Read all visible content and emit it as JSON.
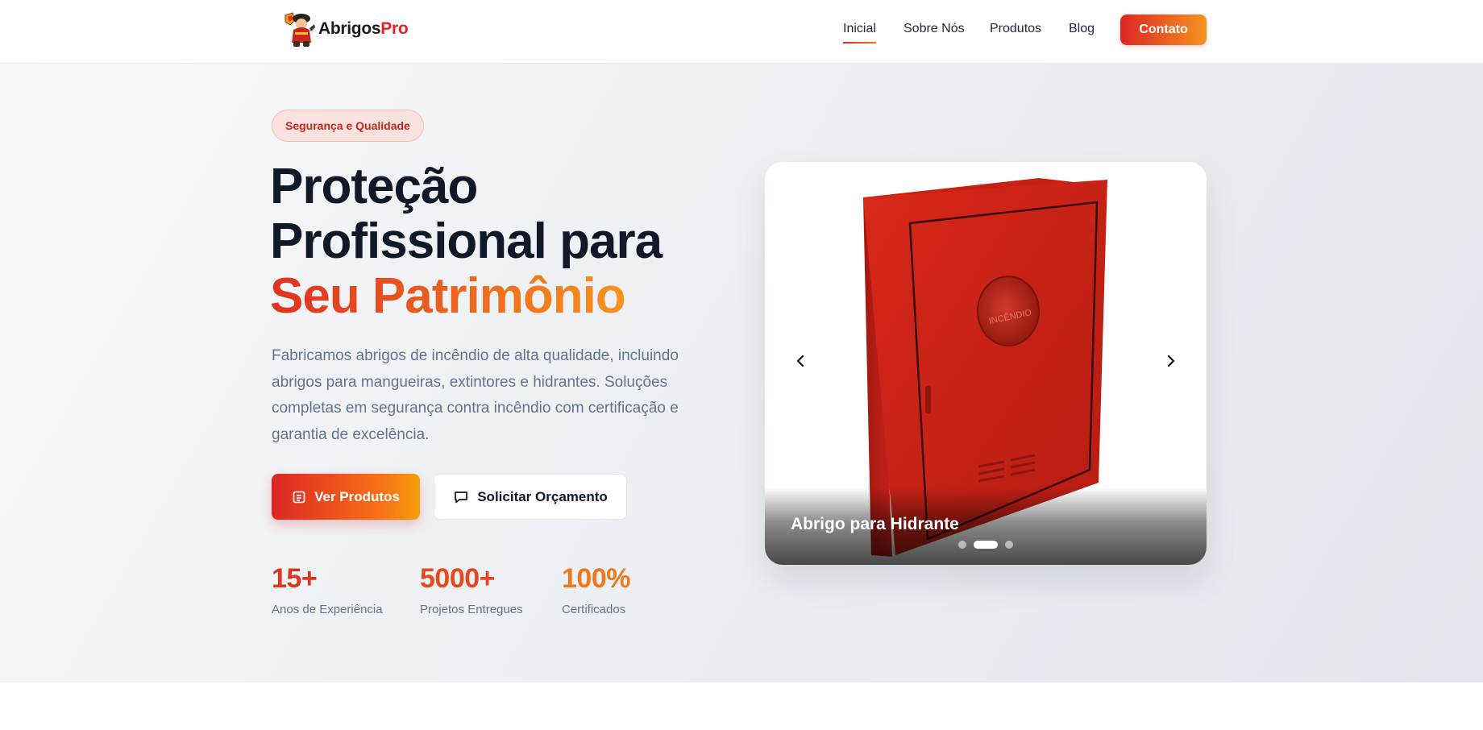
{
  "brand": {
    "name_part1": "Abrigos",
    "name_part2": "Pro"
  },
  "nav": {
    "items": [
      {
        "label": "Inicial",
        "active": true
      },
      {
        "label": "Sobre Nós"
      },
      {
        "label": "Produtos"
      },
      {
        "label": "Blog"
      }
    ],
    "contact_button": "Contato"
  },
  "hero": {
    "badge": "Segurança e Qualidade",
    "title_line1": "Proteção",
    "title_line2": "Profissional para",
    "title_highlight": "Seu Patrimônio",
    "description": "Fabricamos abrigos de incêndio de alta qualidade, incluindo abrigos para mangueiras, extintores e hidrantes. Soluções completas em segurança contra incêndio com certificação e garantia de excelência.",
    "primary_button": "Ver Produtos",
    "secondary_button": "Solicitar Orçamento",
    "stats": [
      {
        "value": "15+",
        "label": "Anos de Experiência"
      },
      {
        "value": "5000+",
        "label": "Projetos Entregues"
      },
      {
        "value": "100%",
        "label": "Certificados"
      }
    ]
  },
  "carousel": {
    "caption": "Abrigo para Hidrante",
    "cabinet_label": "INCÊNDIO",
    "slide_count": 3,
    "active_slide": 2
  },
  "colors": {
    "brand_red": "#dc2626",
    "brand_orange": "#f97316",
    "heading": "#111827",
    "body_text": "#64748b"
  }
}
